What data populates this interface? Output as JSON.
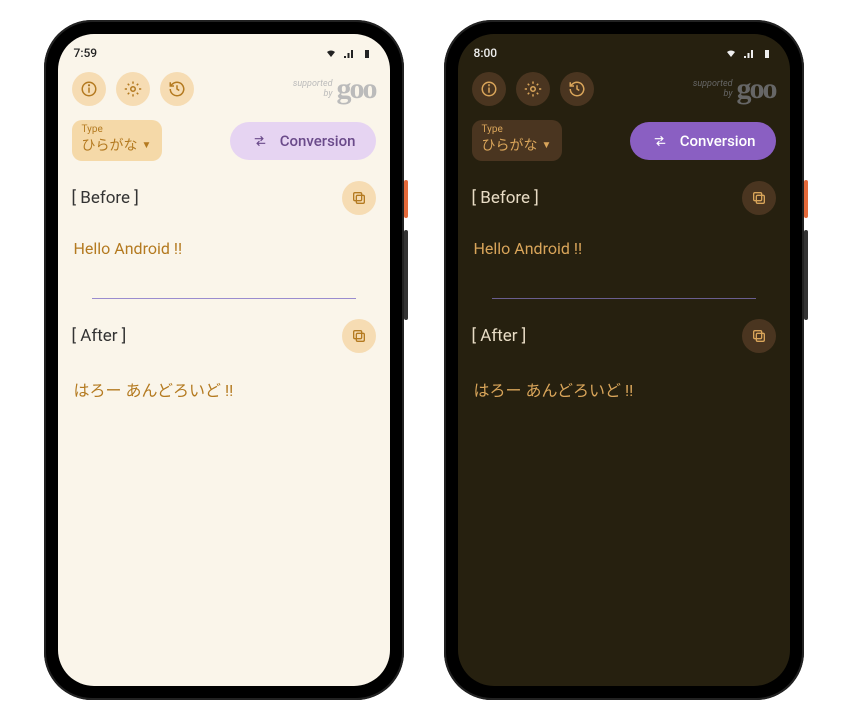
{
  "light": {
    "status": {
      "time": "7:59",
      "icons_left": "◉ ▮"
    },
    "brand": {
      "supported": "supported\nby",
      "logo": "goo"
    },
    "type": {
      "label": "Type",
      "value": "ひらがな"
    },
    "conversion": {
      "label": "Conversion"
    },
    "before": {
      "heading": "[ Before ]",
      "text": "Hello Android !!"
    },
    "after": {
      "heading": "[ After ]",
      "text": "はろー あんどろいど !!"
    }
  },
  "dark": {
    "status": {
      "time": "8:00",
      "icons_left": "◉ ▮"
    },
    "brand": {
      "supported": "supported\nby",
      "logo": "goo"
    },
    "type": {
      "label": "Type",
      "value": "ひらがな"
    },
    "conversion": {
      "label": "Conversion"
    },
    "before": {
      "heading": "[ Before ]",
      "text": "Hello Android !!"
    },
    "after": {
      "heading": "[ After ]",
      "text": "はろー あんどろいど !!"
    }
  }
}
